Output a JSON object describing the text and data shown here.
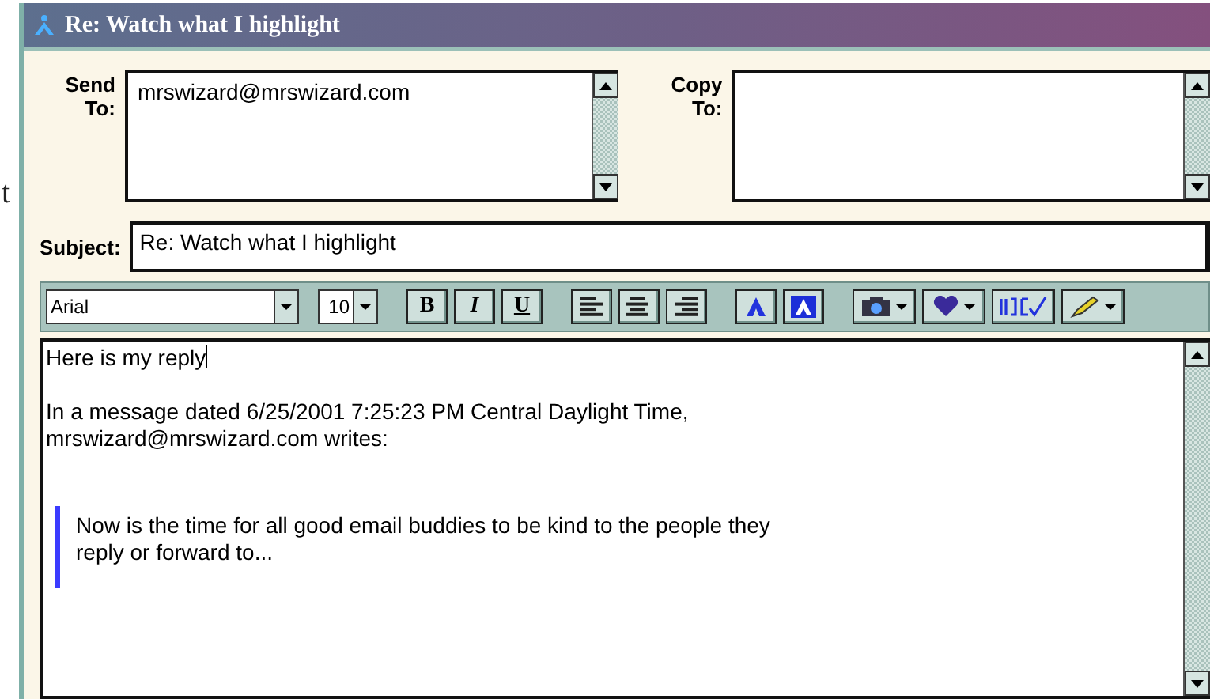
{
  "background_text": "t",
  "window": {
    "title": "Re: Watch what I highlight"
  },
  "send_to": {
    "label_lines": [
      "Send",
      "To:"
    ],
    "value": "mrswizard@mrswizard.com"
  },
  "copy_to": {
    "label_lines": [
      "Copy",
      "To:"
    ]
  },
  "subject": {
    "label": "Subject:",
    "value": "Re: Watch what I highlight"
  },
  "toolbar": {
    "font": "Arial",
    "size": "10",
    "buttons": [
      {
        "kind": "bold",
        "label": "B"
      },
      {
        "kind": "italic",
        "label": "I"
      },
      {
        "kind": "underline",
        "label": "U"
      },
      {
        "kind": "align-left"
      },
      {
        "kind": "align-center"
      },
      {
        "kind": "align-right"
      },
      {
        "kind": "text-color"
      },
      {
        "kind": "background-color"
      },
      {
        "kind": "camera",
        "dropdown": true
      },
      {
        "kind": "heart",
        "dropdown": true
      },
      {
        "kind": "spellcheck",
        "dropdown": false
      },
      {
        "kind": "pen",
        "dropdown": true
      }
    ]
  },
  "message": {
    "paragraphs": [
      {
        "kind": "text",
        "lines": [
          "Here is my reply"
        ]
      },
      {
        "kind": "text",
        "lines": [
          "In a message dated 6/25/2001 7:25:23 PM Central Daylight Time,",
          "mrswizard@mrswizard.com writes:"
        ]
      },
      {
        "kind": "quote",
        "lines": [
          "Now is the time for all good email buddies to be kind to the people they",
          "reply or forward to..."
        ]
      }
    ]
  }
}
